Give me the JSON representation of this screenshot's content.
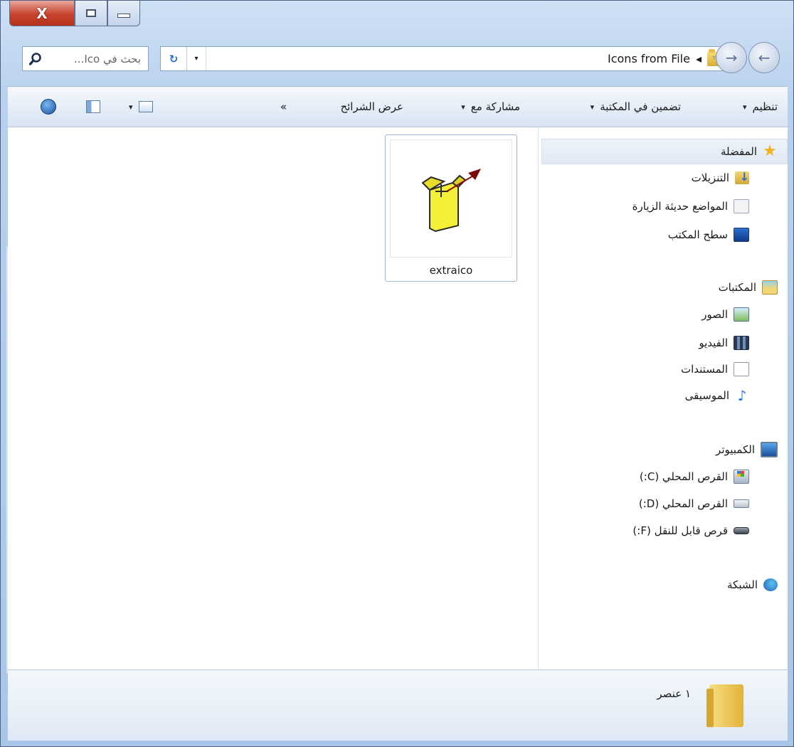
{
  "window": {
    "caption_buttons": {
      "close": "X"
    }
  },
  "address": {
    "search_placeholder": "بحث في Ico...",
    "path": "Icons from File",
    "breadcrumb_arrow": "◂",
    "refresh_symbol": "↻",
    "dropdown_symbol": "▾",
    "back_symbol": "←",
    "forward_symbol": "→",
    "history_symbol": "▿"
  },
  "toolbar": {
    "organize": "تنظيم",
    "include_in_library": "تضمين في المكتبة",
    "share_with": "مشاركة مع",
    "slideshow": "عرض الشرائح",
    "more": "»",
    "dropdown_symbol": "▾"
  },
  "navigation": {
    "favorites": {
      "label": "المفضلة",
      "items": [
        {
          "label": "التنزيلات",
          "icon": "downloads-icon"
        },
        {
          "label": "المواضع حديثة الزيارة",
          "icon": "recent-places-icon"
        },
        {
          "label": "سطح المكتب",
          "icon": "desktop-icon"
        }
      ]
    },
    "libraries": {
      "label": "المكتبات",
      "items": [
        {
          "label": "الصور",
          "icon": "pictures-icon"
        },
        {
          "label": "الفيديو",
          "icon": "videos-icon"
        },
        {
          "label": "المستندات",
          "icon": "documents-icon"
        },
        {
          "label": "الموسيقى",
          "icon": "music-icon"
        }
      ]
    },
    "computer": {
      "label": "الكمبيوتر",
      "items": [
        {
          "label": "القرص المحلي (C:)",
          "icon": "drive-c-icon"
        },
        {
          "label": "القرص المحلي (D:)",
          "icon": "drive-d-icon"
        },
        {
          "label": "قرص قابل للنقل (F:)",
          "icon": "removable-drive-icon"
        }
      ]
    },
    "network": {
      "label": "الشبكة"
    }
  },
  "files": [
    {
      "name": "extraico",
      "icon": "box-export-icon"
    }
  ],
  "status": {
    "count": "١ عنصر"
  },
  "colors": {
    "accent": "#2c6ccf",
    "close_button": "#c7432e",
    "selection_border": "#9db6d3"
  }
}
